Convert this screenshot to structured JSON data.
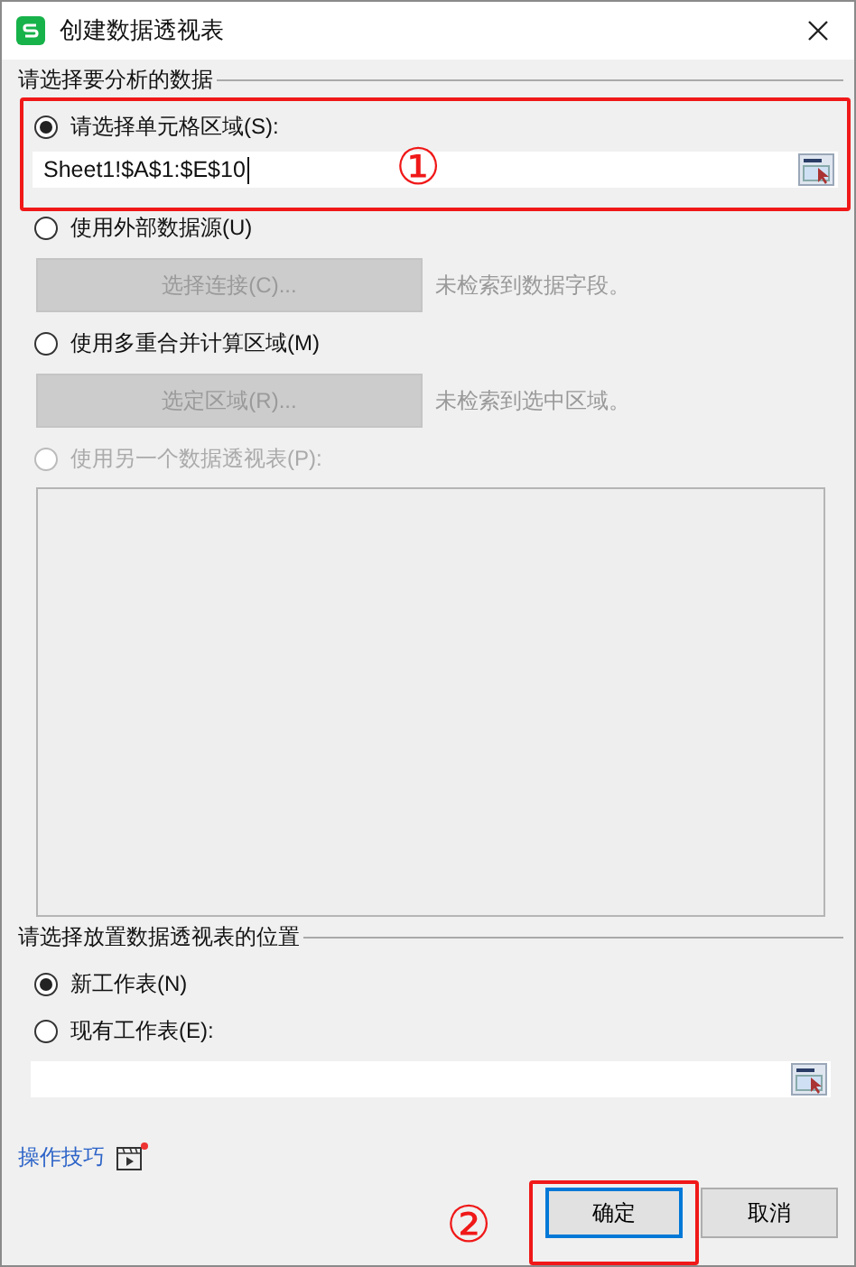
{
  "window": {
    "title": "创建数据透视表"
  },
  "source_section": {
    "label": "请选择要分析的数据",
    "options": [
      {
        "kind": "range",
        "label": "请选择单元格区域(S):",
        "selected": true,
        "disabled": false,
        "value": "Sheet1!$A$1:$E$10"
      },
      {
        "kind": "button",
        "label": "使用外部数据源(U)",
        "selected": false,
        "disabled": false,
        "button": "选择连接(C)...",
        "hint": "未检索到数据字段。"
      },
      {
        "kind": "button",
        "label": "使用多重合并计算区域(M)",
        "selected": false,
        "disabled": false,
        "button": "选定区域(R)...",
        "hint": "未检索到选中区域。"
      },
      {
        "kind": "list",
        "label": "使用另一个数据透视表(P):",
        "selected": false,
        "disabled": true
      }
    ]
  },
  "target_section": {
    "label": "请选择放置数据透视表的位置",
    "options": [
      {
        "label": "新工作表(N)",
        "selected": true
      },
      {
        "label": "现有工作表(E):",
        "selected": false
      }
    ]
  },
  "tips_link": "操作技巧",
  "buttons": [
    {
      "label": "确定",
      "default": true
    },
    {
      "label": "取消",
      "default": false
    }
  ],
  "annotations": [
    {
      "text": "①"
    },
    {
      "text": "②"
    }
  ]
}
